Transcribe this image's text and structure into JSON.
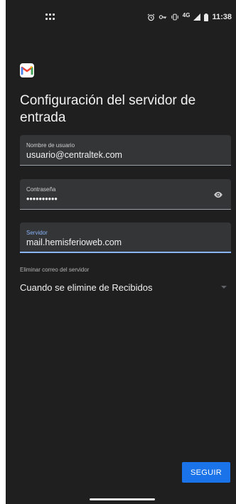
{
  "status_bar": {
    "time": "11:38",
    "network": "4G",
    "icons": [
      "apps-grid-icon",
      "alarm-icon",
      "key-icon",
      "vibrate-icon",
      "signal-icon",
      "battery-icon"
    ]
  },
  "app": {
    "logo": "gmail-logo"
  },
  "page": {
    "title": "Configuración del servidor de entrada"
  },
  "fields": {
    "username": {
      "label": "Nombre de usuario",
      "value": "usuario@centraltek.com"
    },
    "password": {
      "label": "Contraseña",
      "value": "••••••••••"
    },
    "server": {
      "label": "Servidor",
      "value": "mail.hemisferioweb.com"
    }
  },
  "delete_setting": {
    "label": "Eliminar correo del servidor",
    "selected": "Cuando se elimine de Recibidos"
  },
  "actions": {
    "next_label": "SEGUIR"
  },
  "colors": {
    "background": "#1f1f1f",
    "field": "#333537",
    "accent": "#8ab4f8",
    "button": "#1a73e8"
  }
}
